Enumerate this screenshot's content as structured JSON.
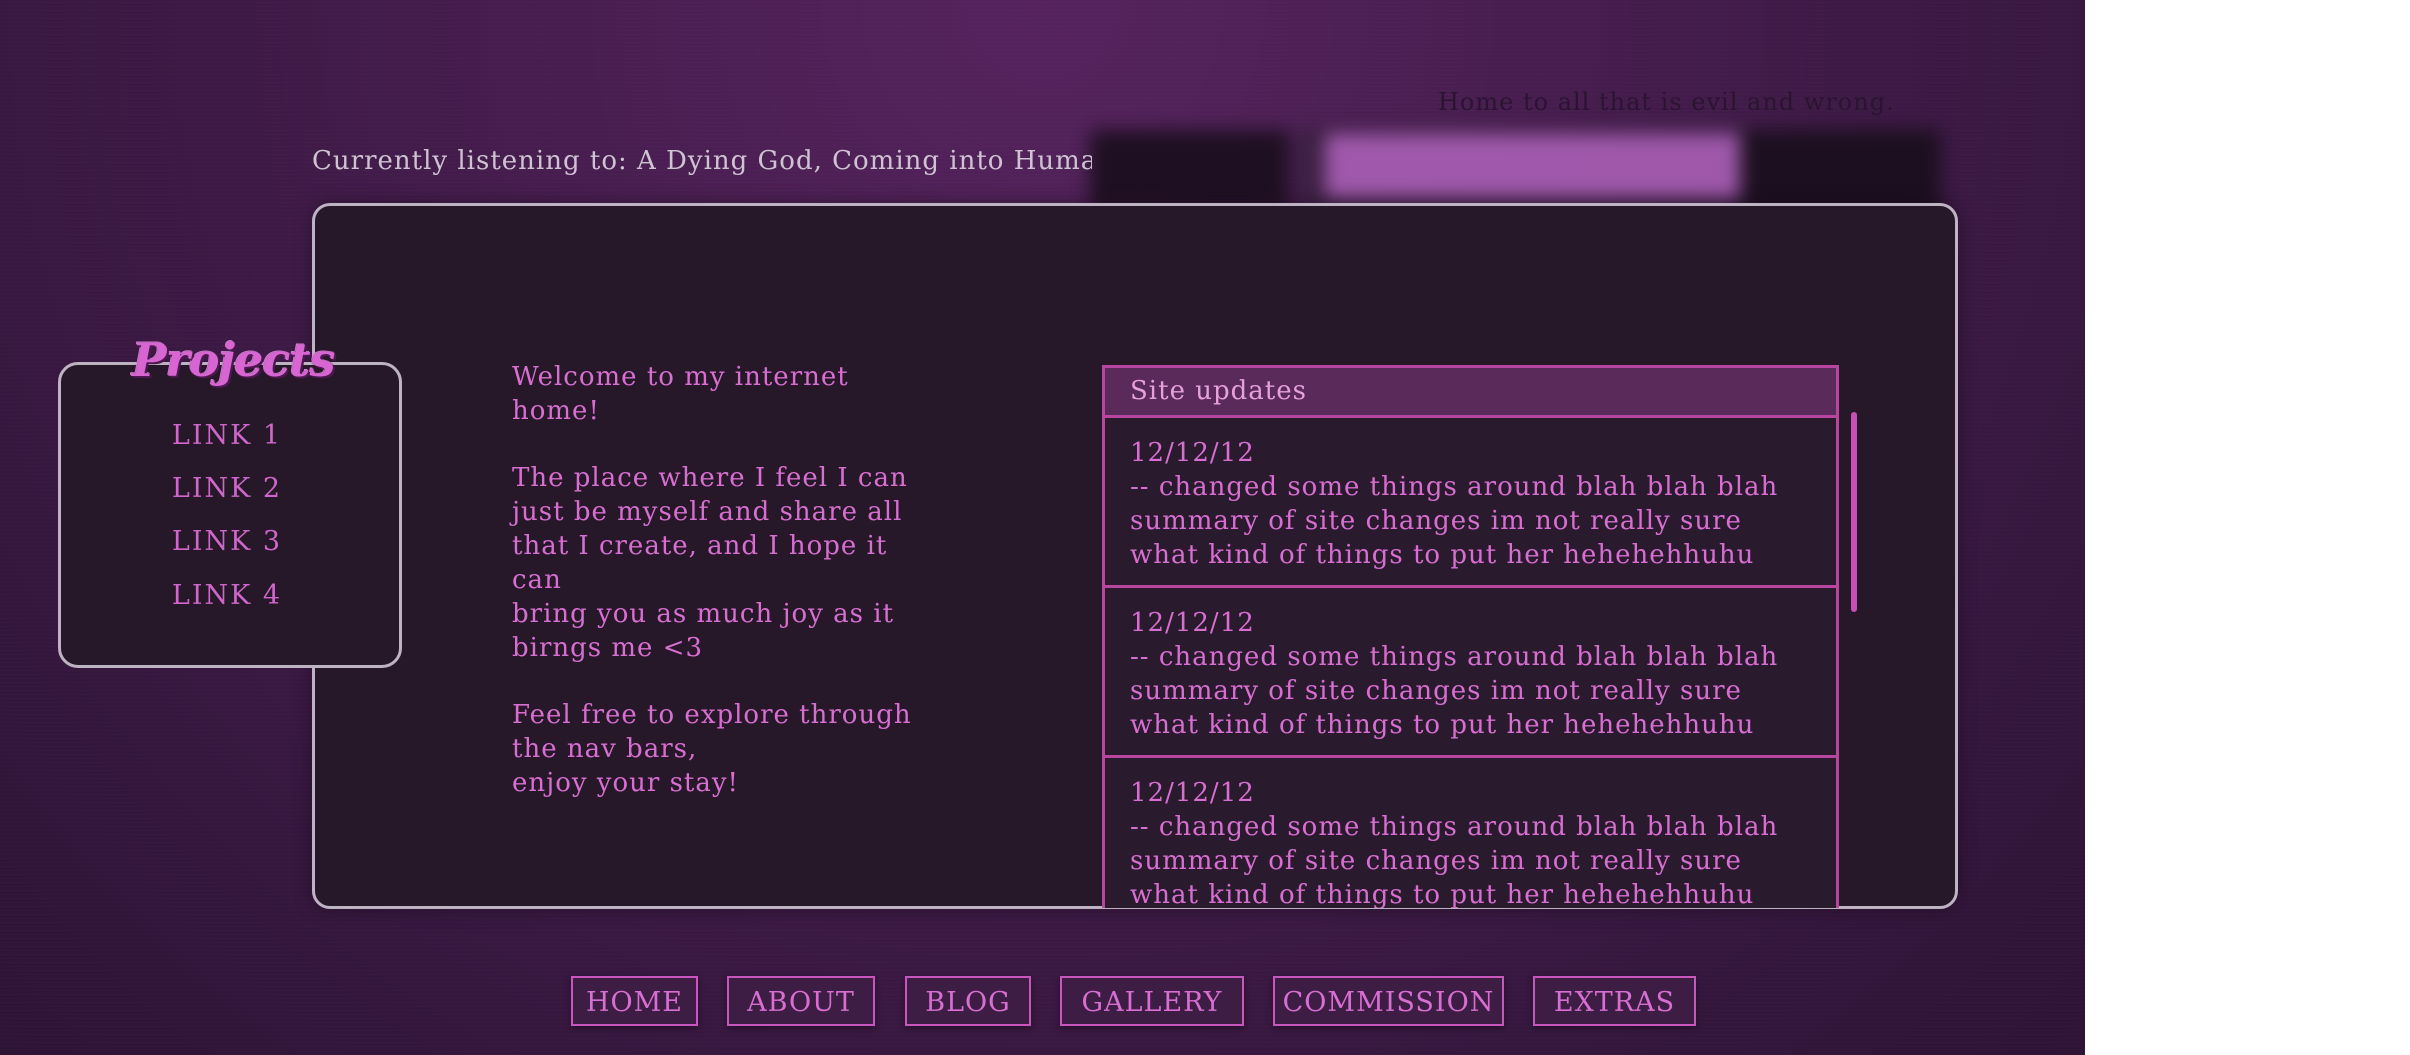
{
  "header": {
    "tagline": "Home to all that is evil and wrong.",
    "listening": "Currently listening to: A Dying God, Coming into Human Flesh",
    "banner_blurred": true
  },
  "sidebar": {
    "title": "Projects",
    "links": [
      "LINK 1",
      "LINK 2",
      "LINK 3",
      "LINK 4"
    ]
  },
  "welcome": {
    "heading": "Welcome to my internet home!",
    "para1_lines": [
      "The place where I feel I can",
      "just be myself and share all",
      "that I create, and I hope it can",
      "bring you as much joy as it",
      "birngs me <3"
    ],
    "para2_lines": [
      "Feel free to explore through",
      "the nav bars,",
      "enjoy your stay!"
    ]
  },
  "updates": {
    "title": "Site updates",
    "entries": [
      {
        "date": "12/12/12",
        "lines": [
          "-- changed some things around blah blah blah",
          "summary of site changes im not really sure",
          "what kind of things to put her hehehehhuhu"
        ]
      },
      {
        "date": "12/12/12",
        "lines": [
          "-- changed some things around blah blah blah",
          "summary of site changes im not really sure",
          "what kind of things to put her hehehehhuhu"
        ]
      },
      {
        "date": "12/12/12",
        "lines": [
          "-- changed some things around blah blah blah",
          "summary of site changes im not really sure",
          "what kind of things to put her hehehehhuhu"
        ]
      }
    ]
  },
  "nav": {
    "buttons": [
      "HOME",
      "ABOUT",
      "BLOG",
      "GALLERY",
      "COMMISSION",
      "EXTRAS"
    ]
  },
  "colors": {
    "background": "#3e1a46",
    "panel": "#261828",
    "panel_border": "#bdb3c2",
    "accent_pink": "#d86ed2",
    "update_border": "#b8459f"
  }
}
